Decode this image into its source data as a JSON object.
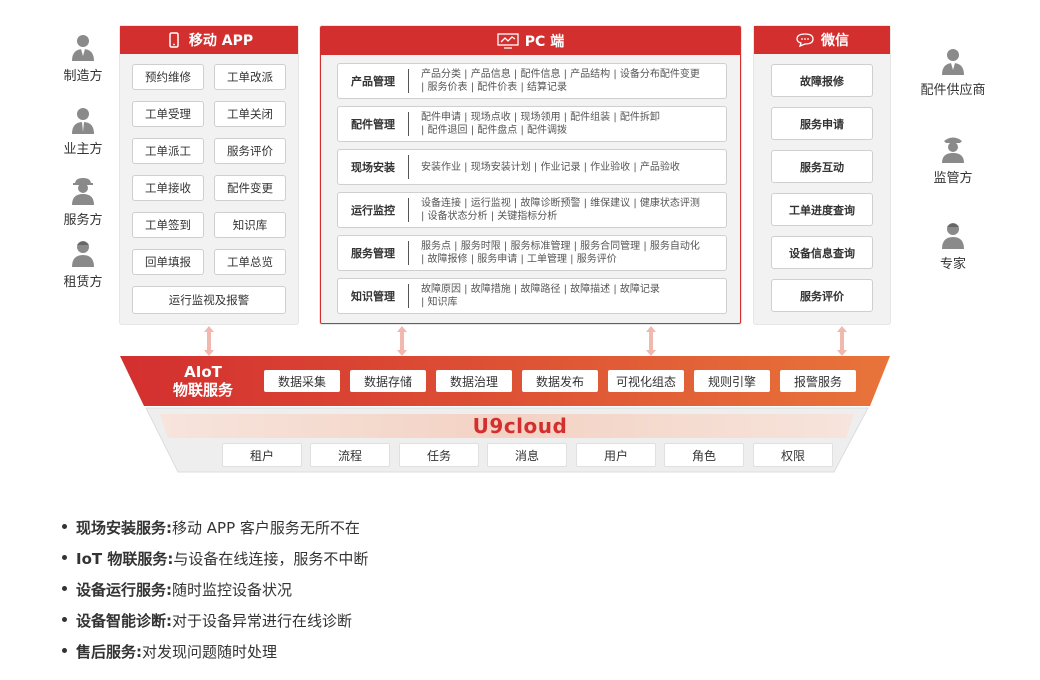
{
  "left_roles": [
    "制造方",
    "业主方",
    "服务方",
    "租赁方"
  ],
  "right_roles": [
    "配件供应商",
    "监管方",
    "专家"
  ],
  "mobile": {
    "title": "移动 APP",
    "buttons": [
      "预约维修",
      "工单改派",
      "工单受理",
      "工单关闭",
      "工单派工",
      "服务评价",
      "工单接收",
      "配件变更",
      "工单签到",
      "知识库",
      "回单填报",
      "工单总览"
    ],
    "wide_button": "运行监视及报警"
  },
  "pc": {
    "title": "PC 端",
    "rows": [
      {
        "name": "产品管理",
        "line1": "产品分类 | 产品信息 | 配件信息 | 产品结构 | 设备分布配件变更",
        "line2": "| 服务价表 | 配件价表 | 结算记录"
      },
      {
        "name": "配件管理",
        "line1": "配件申请 | 现场点收 | 现场领用 | 配件组装 | 配件拆卸",
        "line2": "| 配件退回 | 配件盘点 | 配件调拨"
      },
      {
        "name": "现场安装",
        "line1": "安装作业 | 现场安装计划 | 作业记录 | 作业验收 | 产品验收",
        "line2": ""
      },
      {
        "name": "运行监控",
        "line1": "设备连接 | 运行监视 | 故障诊断预警 | 维保建议 | 健康状态评测",
        "line2": "| 设备状态分析 | 关键指标分析"
      },
      {
        "name": "服务管理",
        "line1": "服务点 | 服务时限 | 服务标准管理 | 服务合同管理 | 服务自动化",
        "line2": "| 故障报修 | 服务申请 | 工单管理 | 服务评价"
      },
      {
        "name": "知识管理",
        "line1": "故障原因 | 故障措施 | 故障路径 | 故障描述 | 故障记录",
        "line2": "| 知识库"
      }
    ]
  },
  "wechat": {
    "title": "微信",
    "buttons": [
      "故障报修",
      "服务申请",
      "服务互动",
      "工单进度查询",
      "设备信息查询",
      "服务评价"
    ]
  },
  "aiot": {
    "line1": "AIoT",
    "line2": "物联服务",
    "chips": [
      "数据采集",
      "数据存储",
      "数据治理",
      "数据发布",
      "可视化组态",
      "规则引擎",
      "报警服务"
    ]
  },
  "u9": {
    "logo": "U9cloud",
    "chips": [
      "租户",
      "流程",
      "任务",
      "消息",
      "用户",
      "角色",
      "权限"
    ]
  },
  "bullets": [
    {
      "title": "现场安装服务:",
      "text": "移动 APP 客户服务无所不在"
    },
    {
      "title": "IoT 物联服务:",
      "text": "与设备在线连接，服务不中断"
    },
    {
      "title": "设备运行服务:",
      "text": "随时监控设备状况"
    },
    {
      "title": "设备智能诊断:",
      "text": "对于设备异常进行在线诊断"
    },
    {
      "title": "售后服务:",
      "text": "对发现问题随时处理"
    }
  ],
  "colors": {
    "brand_red": "#d32f2f",
    "gradient_end": "#e8743a",
    "icon_gray": "#8a8a8a"
  }
}
